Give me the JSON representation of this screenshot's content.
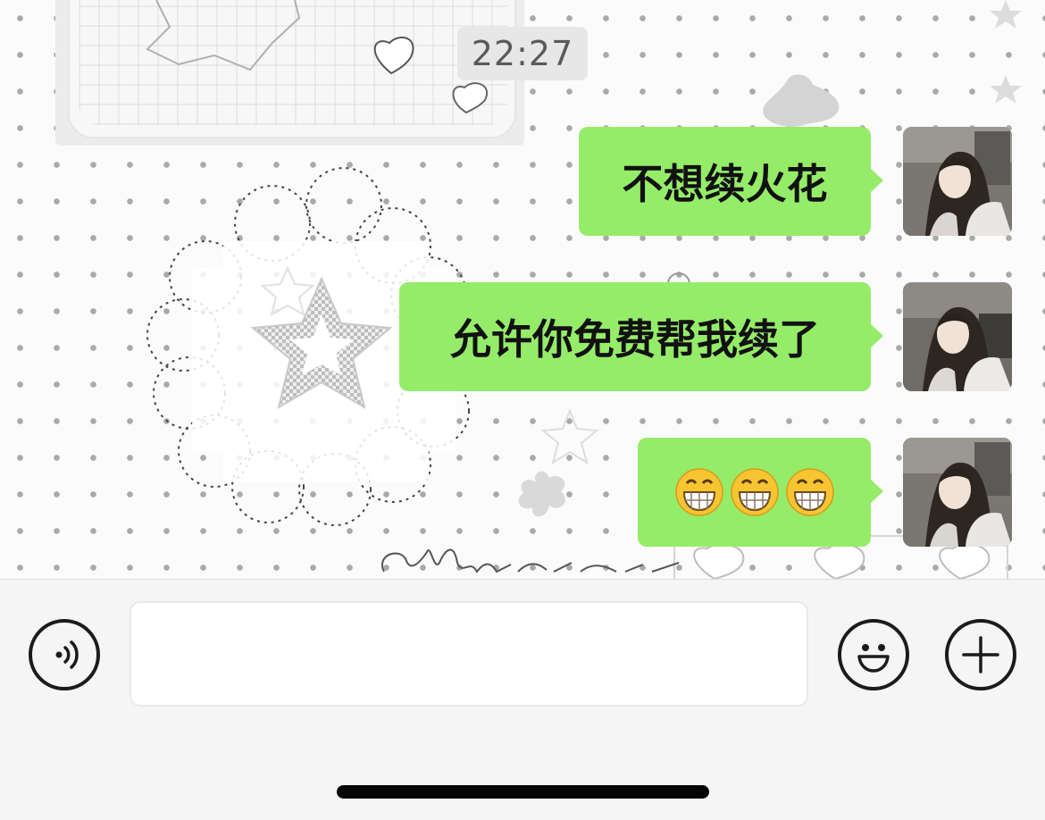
{
  "timestamp": "22:27",
  "messages": [
    {
      "text": "不想续火花",
      "sender": "self"
    },
    {
      "text": "允许你免费帮我续了",
      "sender": "self"
    },
    {
      "text": "",
      "sender": "self",
      "emojis": [
        "grinning-face-icon",
        "grinning-face-icon",
        "grinning-face-icon"
      ]
    }
  ],
  "input": {
    "value": "",
    "placeholder": ""
  },
  "colors": {
    "bubble": "#95ec69",
    "chat_bg": "#fbfbfb",
    "input_bar_bg": "#f5f5f5",
    "timestamp_bg": "#e7e7e7"
  }
}
